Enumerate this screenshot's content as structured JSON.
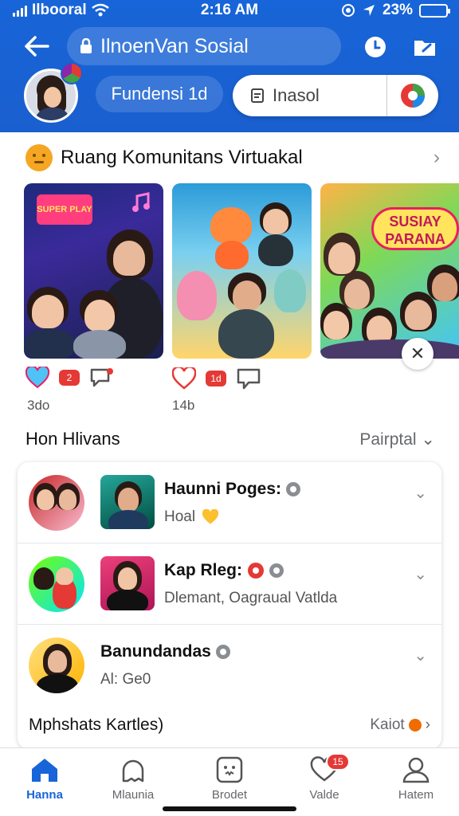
{
  "status_bar": {
    "carrier": "Ilbooral",
    "time": "2:16 AM",
    "battery": "23%",
    "battery_level": 0.23
  },
  "header": {
    "title": "IlnoenVan Sosial",
    "sub_pill": "Fundensi 1d",
    "search_label": "Inasol"
  },
  "community": {
    "title": "Ruang Komunitans Virtuakal",
    "cards": [
      {
        "banner": "SUPER PLAY"
      },
      {
        "banner": ""
      },
      {
        "sticker": "SUSIAY PARANA"
      }
    ],
    "reactions": [
      {
        "count": "3do",
        "badge": "2"
      },
      {
        "count": "14b",
        "badge": "1d"
      }
    ]
  },
  "groups": {
    "title": "Hon Hlivans",
    "filter": "Pairptal",
    "rows": [
      {
        "name": "Haunni Poges:",
        "sub": "Hoal"
      },
      {
        "name": "Kap Rleg:",
        "sub": "Dlemant, Oagraual Vatlda"
      },
      {
        "name": "Banundandas",
        "sub": "Al: Ge0"
      }
    ],
    "more_title": "Mphshats Kartles)",
    "more_link": "Kaiot"
  },
  "bottom_nav": {
    "items": [
      {
        "label": "Hanna",
        "icon": "home-icon",
        "active": true
      },
      {
        "label": "Mlaunia",
        "icon": "community-icon"
      },
      {
        "label": "Brodet",
        "icon": "square-face-icon"
      },
      {
        "label": "Valde",
        "icon": "heart-chat-icon",
        "badge": "15"
      },
      {
        "label": "Hatem",
        "icon": "profile-icon"
      }
    ]
  },
  "colors": {
    "brand": "#1765d8",
    "badge": "#e53935"
  }
}
